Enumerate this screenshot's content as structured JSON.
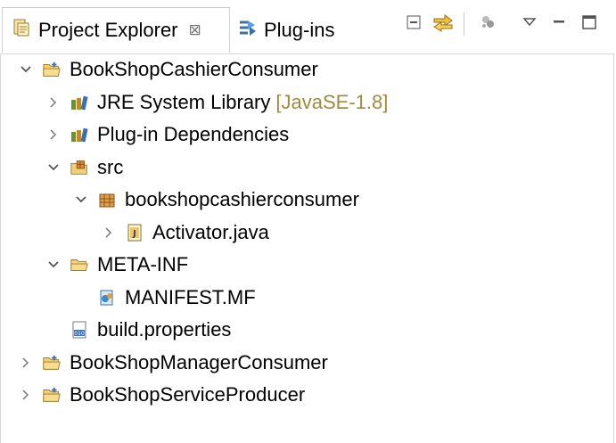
{
  "tabs": {
    "active_label": "Project Explorer",
    "close_glyph": "⊠",
    "inactive_label": "Plug-ins"
  },
  "tree": [
    {
      "label": "BookShopCashierConsumer",
      "icon": "project-icon",
      "twisty": "expanded",
      "depth": 0
    },
    {
      "label": "JRE System Library",
      "decoration": "[JavaSE-1.8]",
      "icon": "library-icon",
      "twisty": "collapsed",
      "depth": 1
    },
    {
      "label": "Plug-in Dependencies",
      "icon": "library-icon",
      "twisty": "collapsed",
      "depth": 1
    },
    {
      "label": "src",
      "icon": "source-folder-icon",
      "twisty": "expanded",
      "depth": 1
    },
    {
      "label": "bookshopcashierconsumer",
      "icon": "package-icon",
      "twisty": "expanded",
      "depth": 2
    },
    {
      "label": "Activator.java",
      "icon": "java-file-icon",
      "twisty": "collapsed",
      "depth": 3
    },
    {
      "label": "META-INF",
      "icon": "folder-icon",
      "twisty": "expanded",
      "depth": 1
    },
    {
      "label": "MANIFEST.MF",
      "icon": "manifest-icon",
      "twisty": "none",
      "depth": 2
    },
    {
      "label": "build.properties",
      "icon": "properties-file-icon",
      "twisty": "none",
      "depth": 1
    },
    {
      "label": "BookShopManagerConsumer",
      "icon": "project-icon",
      "twisty": "collapsed",
      "depth": 0
    },
    {
      "label": "BookShopServiceProducer",
      "icon": "project-icon",
      "twisty": "collapsed",
      "depth": 0
    }
  ]
}
